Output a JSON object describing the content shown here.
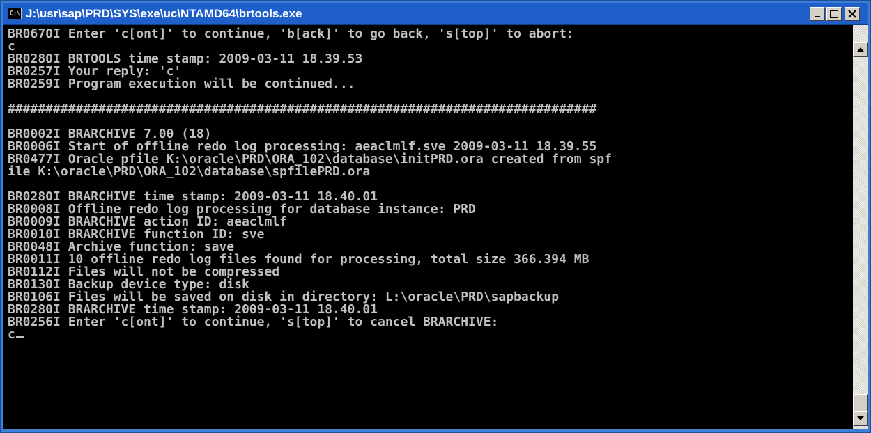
{
  "window": {
    "title": "J:\\usr\\sap\\PRD\\SYS\\exe\\uc\\NTAMD64\\brtools.exe",
    "icon_label": "C:\\",
    "buttons": {
      "minimize": "minimize",
      "maximize": "maximize",
      "close": "close"
    }
  },
  "console": {
    "foreground": "#c0c0c0",
    "background": "#000000",
    "lines": [
      "BR0670I Enter 'c[ont]' to continue, 'b[ack]' to go back, 's[top]' to abort:",
      "c",
      "BR0280I BRTOOLS time stamp: 2009-03-11 18.39.53",
      "BR0257I Your reply: 'c'",
      "BR0259I Program execution will be continued...",
      "",
      "##############################################################################",
      "",
      "BR0002I BRARCHIVE 7.00 (18)",
      "BR0006I Start of offline redo log processing: aeaclmlf.sve 2009-03-11 18.39.55",
      "BR0477I Oracle pfile K:\\oracle\\PRD\\ORA_102\\database\\initPRD.ora created from spf",
      "ile K:\\oracle\\PRD\\ORA_102\\database\\spfilePRD.ora",
      "",
      "BR0280I BRARCHIVE time stamp: 2009-03-11 18.40.01",
      "BR0008I Offline redo log processing for database instance: PRD",
      "BR0009I BRARCHIVE action ID: aeaclmlf",
      "BR0010I BRARCHIVE function ID: sve",
      "BR0048I Archive function: save",
      "BR0011I 10 offline redo log files found for processing, total size 366.394 MB",
      "BR0112I Files will not be compressed",
      "BR0130I Backup device type: disk",
      "BR0106I Files will be saved on disk in directory: L:\\oracle\\PRD\\sapbackup",
      "BR0280I BRARCHIVE time stamp: 2009-03-11 18.40.01",
      "BR0256I Enter 'c[ont]' to continue, 's[top]' to cancel BRARCHIVE:",
      "c"
    ]
  },
  "scrollbar": {
    "position_fraction": 0.97
  }
}
